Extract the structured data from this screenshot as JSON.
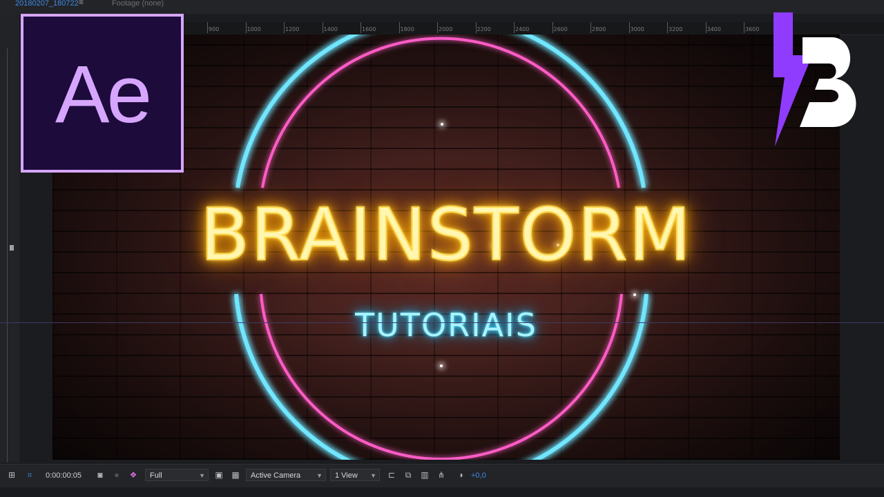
{
  "tabs": {
    "composition_name": "20180207_180722",
    "footage_label": "Footage (none)"
  },
  "ruler": {
    "labels": [
      "900",
      "1000",
      "1200",
      "1400",
      "1600",
      "1800",
      "2000",
      "2200",
      "2400",
      "2600",
      "2800",
      "3000",
      "3200",
      "3400",
      "3600"
    ]
  },
  "canvas": {
    "title": "BRAINSTORM",
    "subtitle": "TUTORIAIS",
    "colors": {
      "title_glow": "#ffcc33",
      "subtitle_glow": "#1ec8ff",
      "outer_ring": "#3fd8ff",
      "inner_ring": "#ff3fb0"
    }
  },
  "overlay": {
    "ae_logo_text": "Ae",
    "brand_logo_icon": "brainstorm-b-logo-icon"
  },
  "viewer_toolbar": {
    "timecode": "0:00:00:05",
    "resolution": "Full",
    "camera": "Active Camera",
    "view_layout": "1 View",
    "exposure": "+0,0"
  }
}
